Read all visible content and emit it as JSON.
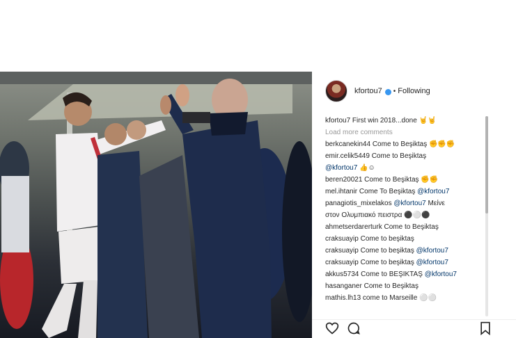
{
  "post": {
    "username": "kfortou7",
    "following_label": "Following",
    "caption_user": "kfortou7",
    "caption_text": "First win 2018...done 🤘🤘",
    "load_more": "Load more comments"
  },
  "comments": [
    {
      "user": "berkcanekin44",
      "text": "Come to Beşiktaş ✊✊✊",
      "mention": ""
    },
    {
      "user": "emir.celik5449",
      "text": "Come to Beşiktaş",
      "mention": ""
    },
    {
      "user": "",
      "text": "👍☺",
      "mention": "@kfortou7"
    },
    {
      "user": "beren20021",
      "text": "Come to Beşiktaş ✊✊",
      "mention": ""
    },
    {
      "user": "mel.ihtanir",
      "text": "Come To Beşiktaş",
      "mention": "@kfortou7"
    },
    {
      "user": "panagiotis_mixelakos",
      "text": "Μείνε",
      "mention": "@kfortou7"
    },
    {
      "user": "",
      "text": "στον Ολυμπιακό πειστρα ⚫⚪⚫",
      "mention": ""
    },
    {
      "user": "ahmetserdarerturk",
      "text": "Come to Beşiktaş",
      "mention": ""
    },
    {
      "user": "craksuayip",
      "text": "Come to beşiktaş",
      "mention": ""
    },
    {
      "user": "craksuayip",
      "text": "Come to beşiktaş",
      "mention": "@kfortou7"
    },
    {
      "user": "craksuayip",
      "text": "Come to beşiktaş",
      "mention": "@kfortou7"
    },
    {
      "user": "akkus5734",
      "text": "Come to BEŞIKTAŞ",
      "mention": "@kfortou7"
    },
    {
      "user": "hasanganer",
      "text": "Come to Beşiktaş",
      "mention": ""
    },
    {
      "user": "mathis.lh13",
      "text": "come to Marseille ⚪⚪",
      "mention": ""
    }
  ],
  "icons": [
    "heart-icon",
    "comment-icon",
    "bookmark-icon",
    "verified-icon"
  ],
  "colors": {
    "verified": "#3897f0",
    "mention": "#003569"
  }
}
